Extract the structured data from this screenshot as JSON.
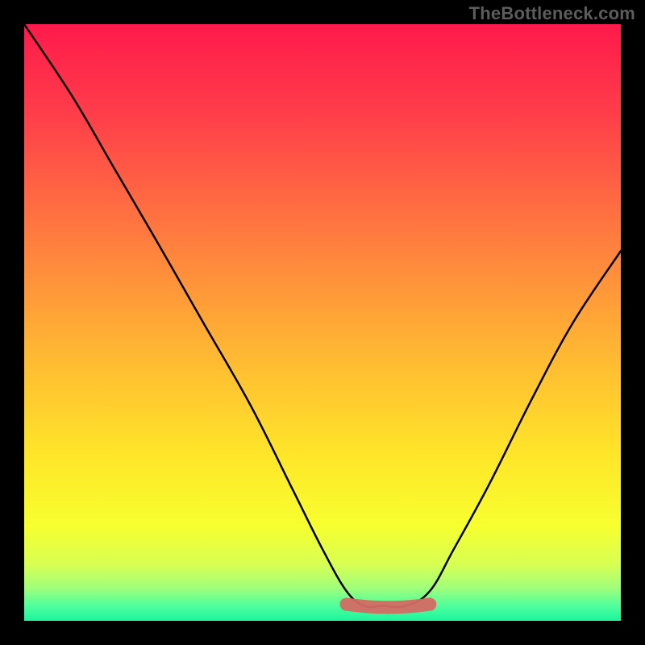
{
  "watermark": "TheBottleneck.com",
  "colors": {
    "black": "#000000",
    "curve": "#000000",
    "valley_marker": "#d46a63",
    "gradient_stops": [
      {
        "offset": 0.0,
        "color": "#ff1a4b"
      },
      {
        "offset": 0.15,
        "color": "#ff3d4a"
      },
      {
        "offset": 0.35,
        "color": "#ff7a3f"
      },
      {
        "offset": 0.55,
        "color": "#ffb733"
      },
      {
        "offset": 0.72,
        "color": "#ffe529"
      },
      {
        "offset": 0.84,
        "color": "#f7ff2e"
      },
      {
        "offset": 0.905,
        "color": "#d8ff52"
      },
      {
        "offset": 0.945,
        "color": "#9fff7a"
      },
      {
        "offset": 0.975,
        "color": "#4fff9d"
      },
      {
        "offset": 1.0,
        "color": "#1cf59d"
      }
    ]
  },
  "chart_data": {
    "type": "line",
    "title": "",
    "xlabel": "",
    "ylabel": "",
    "xlim": [
      0,
      100
    ],
    "ylim": [
      0,
      100
    ],
    "grid": false,
    "legend": false,
    "series": [
      {
        "name": "bottleneck-curve",
        "x": [
          0,
          8,
          15,
          22,
          30,
          38,
          45,
          50,
          54,
          57,
          60,
          64,
          68,
          72,
          78,
          85,
          92,
          100
        ],
        "values": [
          100,
          88,
          76,
          64,
          50,
          36,
          22,
          12,
          5,
          2.5,
          2.5,
          2.5,
          5,
          12,
          23,
          37,
          50,
          62
        ]
      }
    ],
    "valley_marker": {
      "x_start": 54,
      "x_end": 68,
      "y": 2.5,
      "thickness_pct": 2.2
    }
  }
}
